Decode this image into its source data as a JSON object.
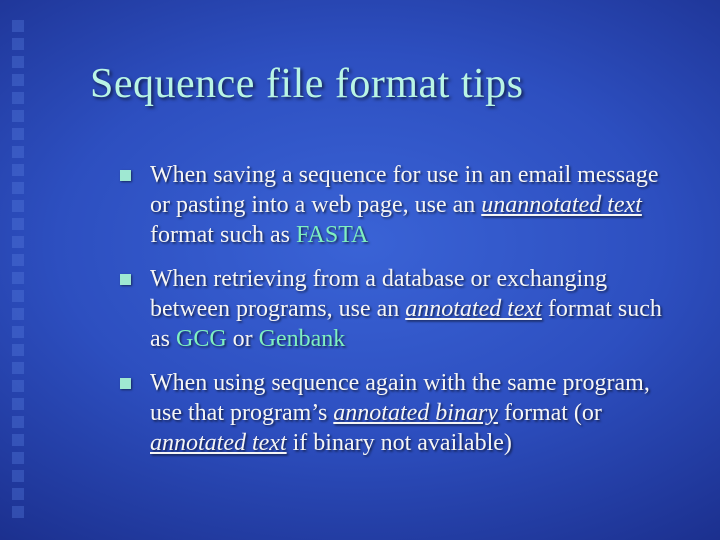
{
  "title": "Sequence file format tips",
  "bullets": {
    "b1": {
      "t1": "When saving a sequence for use in an email message or pasting into a web page, use an ",
      "unannotated_text": "unannotated text",
      "t2": " format such as ",
      "fasta": "FASTA"
    },
    "b2": {
      "t1": "When retrieving from a database or exchanging between programs, use an ",
      "annotated_text": "annotated text",
      "t2": " format such as ",
      "gcg": "GCG",
      "or": " or ",
      "genbank": "Genbank"
    },
    "b3": {
      "t1": "When using sequence again with the same program, use that program’s ",
      "annotated_binary": "annotated binary",
      "t2": " format (or ",
      "annotated_text": "annotated text",
      "t3": " if binary not available)"
    }
  }
}
